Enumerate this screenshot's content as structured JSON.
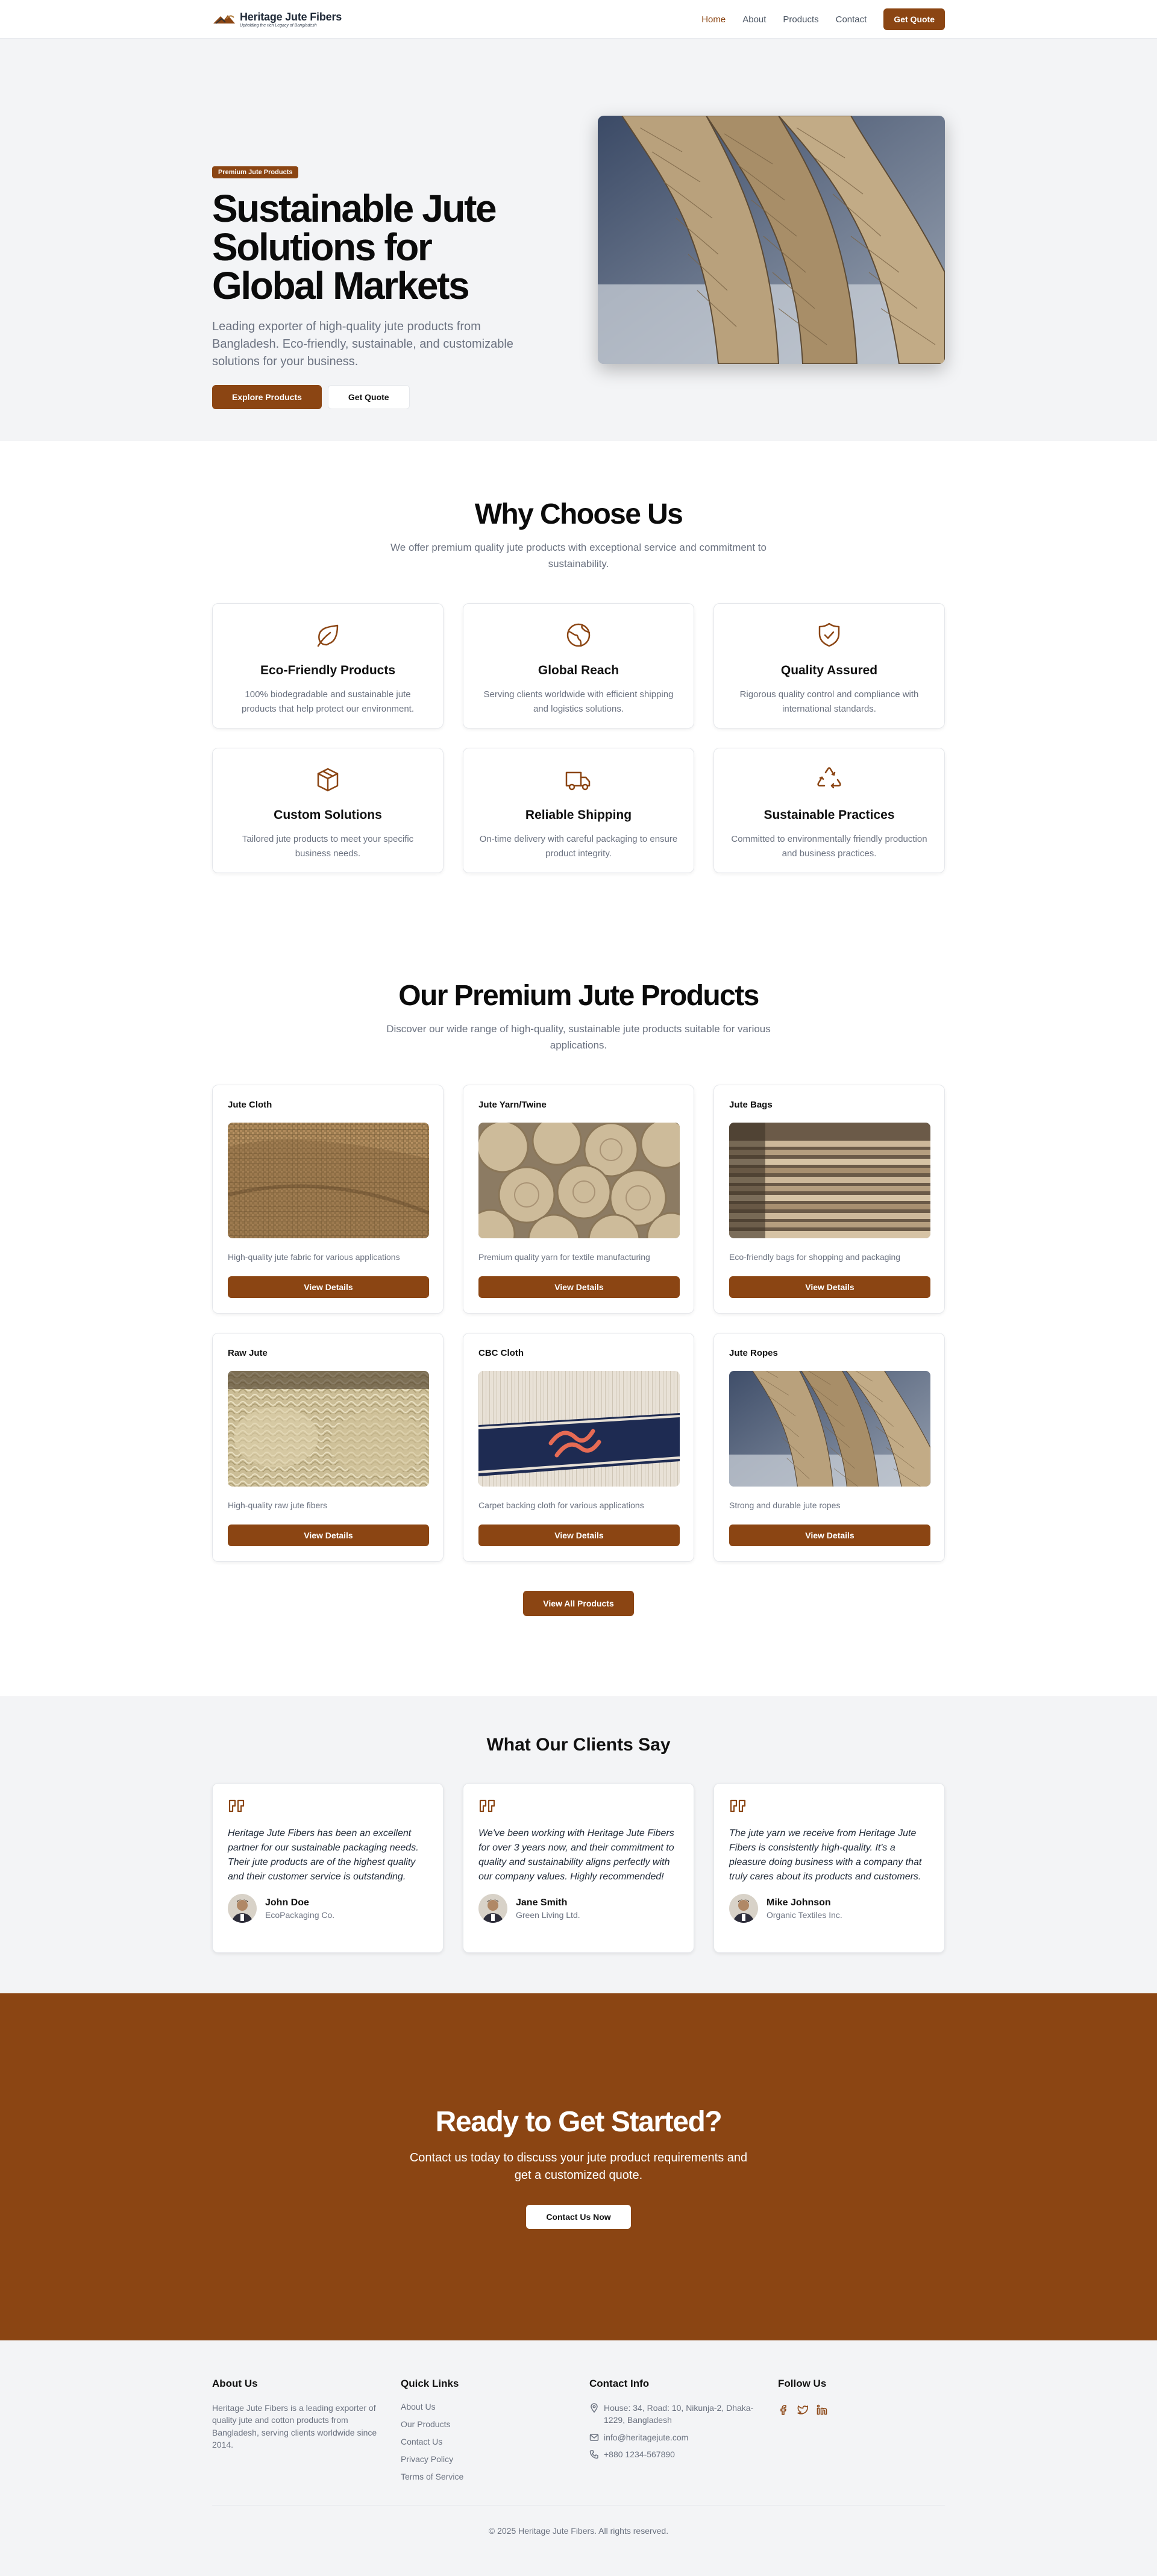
{
  "nav": {
    "brand": "Heritage Jute Fibers",
    "tagline": "Upholding the rich Legacy of Bangladesh",
    "links": [
      "Home",
      "About",
      "Products",
      "Contact"
    ],
    "cta": "Get Quote"
  },
  "hero": {
    "badge": "Premium Jute Products",
    "title": "Sustainable Jute Solutions for Global Markets",
    "subtitle": "Leading exporter of high-quality jute products from Bangladesh. Eco-friendly, sustainable, and customizable solutions for your business.",
    "primary_btn": "Explore Products",
    "secondary_btn": "Get Quote"
  },
  "why": {
    "title": "Why Choose Us",
    "subtitle": "We offer premium quality jute products with exceptional service and commitment to sustainability.",
    "features": [
      {
        "icon": "leaf-icon",
        "title": "Eco-Friendly Products",
        "desc": "100% biodegradable and sustainable jute products that help protect our environment."
      },
      {
        "icon": "globe-icon",
        "title": "Global Reach",
        "desc": "Serving clients worldwide with efficient shipping and logistics solutions."
      },
      {
        "icon": "shield-check-icon",
        "title": "Quality Assured",
        "desc": "Rigorous quality control and compliance with international standards."
      },
      {
        "icon": "package-icon",
        "title": "Custom Solutions",
        "desc": "Tailored jute products to meet your specific business needs."
      },
      {
        "icon": "truck-icon",
        "title": "Reliable Shipping",
        "desc": "On-time delivery with careful packaging to ensure product integrity."
      },
      {
        "icon": "recycle-icon",
        "title": "Sustainable Practices",
        "desc": "Committed to environmentally friendly production and business practices."
      }
    ]
  },
  "products": {
    "title": "Our Premium Jute Products",
    "subtitle": "Discover our wide range of high-quality, sustainable jute products suitable for various applications.",
    "items": [
      {
        "name": "Jute Cloth",
        "desc": "High-quality jute fabric for various applications",
        "btn": "View Details"
      },
      {
        "name": "Jute Yarn/Twine",
        "desc": "Premium quality yarn for textile manufacturing",
        "btn": "View Details"
      },
      {
        "name": "Jute Bags",
        "desc": "Eco-friendly bags for shopping and packaging",
        "btn": "View Details"
      },
      {
        "name": "Raw Jute",
        "desc": "High-quality raw jute fibers",
        "btn": "View Details"
      },
      {
        "name": "CBC Cloth",
        "desc": "Carpet backing cloth for various applications",
        "btn": "View Details"
      },
      {
        "name": "Jute Ropes",
        "desc": "Strong and durable jute ropes",
        "btn": "View Details"
      }
    ],
    "view_all": "View All Products"
  },
  "testimonials": {
    "title": "What Our Clients Say",
    "items": [
      {
        "quote": "Heritage Jute Fibers has been an excellent partner for our sustainable packaging needs. Their jute products are of the highest quality and their customer service is outstanding.",
        "name": "John Doe",
        "company": "EcoPackaging Co."
      },
      {
        "quote": "We've been working with Heritage Jute Fibers for over 3 years now, and their commitment to quality and sustainability aligns perfectly with our company values. Highly recommended!",
        "name": "Jane Smith",
        "company": "Green Living Ltd."
      },
      {
        "quote": "The jute yarn we receive from Heritage Jute Fibers is consistently high-quality. It's a pleasure doing business with a company that truly cares about its products and customers.",
        "name": "Mike Johnson",
        "company": "Organic Textiles Inc."
      }
    ]
  },
  "cta": {
    "title": "Ready to Get Started?",
    "subtitle": "Contact us today to discuss your jute product requirements and get a customized quote.",
    "btn": "Contact Us Now"
  },
  "footer": {
    "about_title": "About Us",
    "about_text": "Heritage Jute Fibers is a leading exporter of quality jute and cotton products from Bangladesh, serving clients worldwide since 2014.",
    "links_title": "Quick Links",
    "links": [
      "About Us",
      "Our Products",
      "Contact Us",
      "Privacy Policy",
      "Terms of Service"
    ],
    "contact_title": "Contact Info",
    "address": "House: 34, Road: 10, Nikunja-2, Dhaka-1229, Bangladesh",
    "email": "info@heritagejute.com",
    "phone": "+880 1234-567890",
    "follow_title": "Follow Us",
    "copyright": "© 2025 Heritage Jute Fibers. All rights reserved."
  },
  "colors": {
    "brand": "#8b4513",
    "muted": "#6b7280",
    "bg_alt": "#f3f4f6"
  }
}
